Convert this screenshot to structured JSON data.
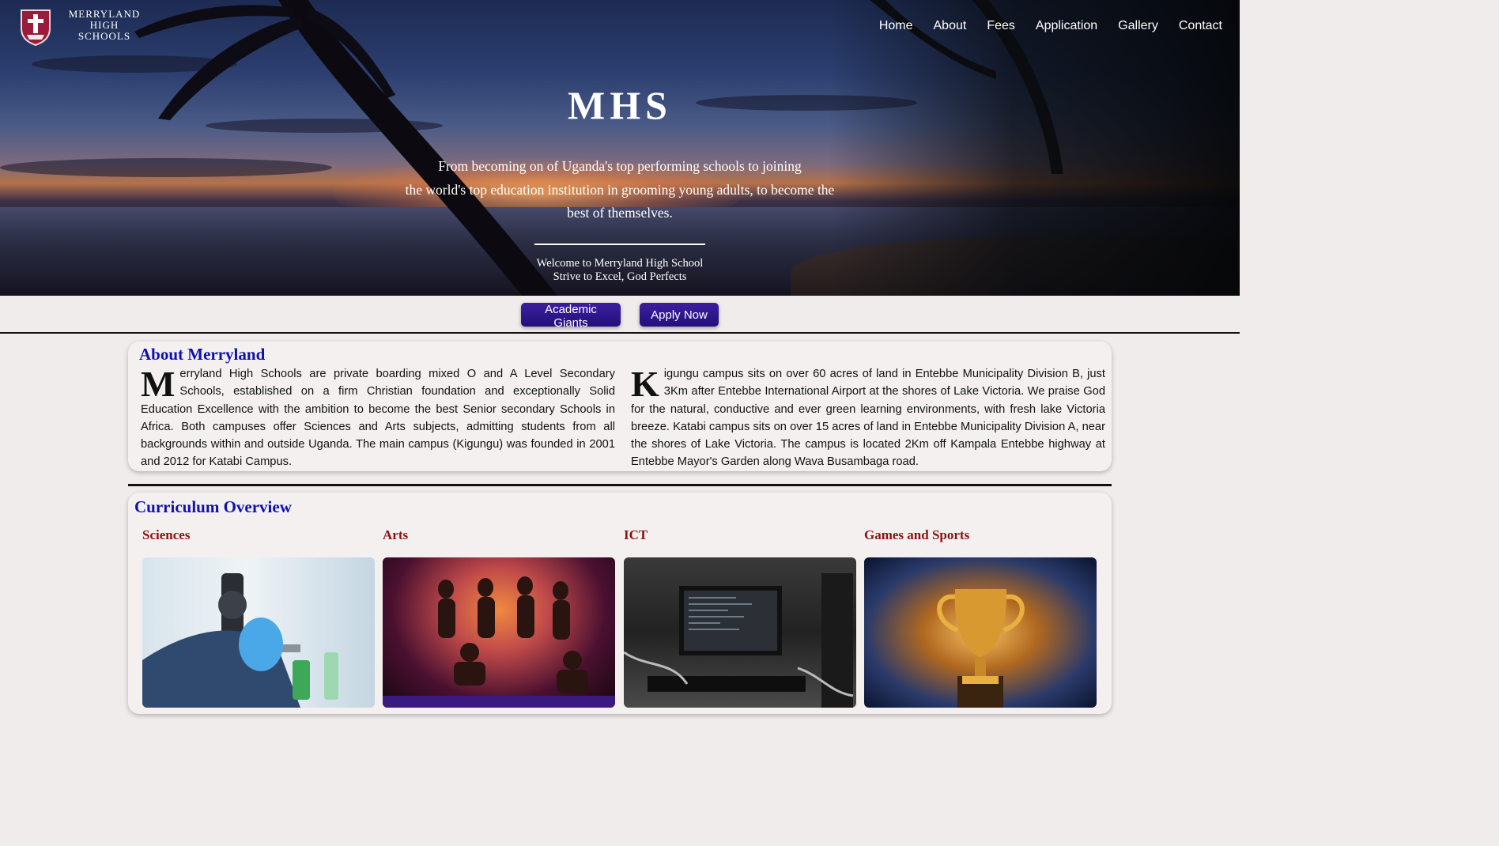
{
  "brand": {
    "line1": "MERRYLAND HIGH",
    "line2": "SCHOOLS"
  },
  "nav": [
    {
      "label": "Home"
    },
    {
      "label": "About"
    },
    {
      "label": "Fees"
    },
    {
      "label": "Application"
    },
    {
      "label": "Gallery"
    },
    {
      "label": "Contact"
    }
  ],
  "hero": {
    "title": "MHS",
    "tagline_1": "From becoming on of Uganda's top performing schools to joining",
    "tagline_2": "the world's top education institution in grooming young adults, to become the",
    "tagline_3": "best of themselves.",
    "welcome": "Welcome to Merryland High School",
    "motto": "Strive to Excel, God Perfects"
  },
  "buttons": {
    "academic": "Academic Giants",
    "apply": "Apply Now"
  },
  "about": {
    "heading": "About Merryland",
    "left_initial": "M",
    "left_text": "erryland High Schools are private boarding mixed O and A Level Secondary Schools, established on a firm Christian foundation and exceptionally Solid Education Excellence with the ambition to become the best Senior secondary Schools in Africa. Both campuses offer Sciences and Arts subjects, admitting students from all backgrounds within and outside Uganda. The main campus (Kigungu) was founded in 2001 and 2012 for Katabi Campus.",
    "right_initial": "K",
    "right_text": "igungu campus sits on over 60 acres of land in Entebbe Municipality Division B, just 3Km after Entebbe International Airport at the shores of Lake Victoria. We praise God for the natural, conductive and ever green learning environments, with fresh lake Victoria breeze. Katabi campus sits on over 15 acres of land in Entebbe Municipality Division A, near the shores of Lake Victoria. The campus is located 2Km off Kampala Entebbe highway at Entebbe Mayor's Garden along Wava Busambaga road."
  },
  "curriculum": {
    "heading": "Curriculum Overview",
    "items": [
      {
        "label": "Sciences"
      },
      {
        "label": "Arts"
      },
      {
        "label": "ICT"
      },
      {
        "label": "Games and Sports"
      }
    ]
  }
}
